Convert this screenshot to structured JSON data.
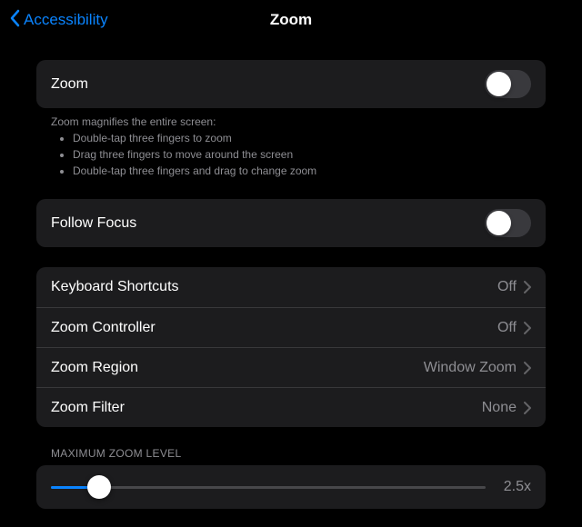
{
  "nav": {
    "back_label": "Accessibility",
    "title": "Zoom"
  },
  "zoom_toggle": {
    "label": "Zoom"
  },
  "zoom_help": {
    "intro": "Zoom magnifies the entire screen:",
    "tips": [
      "Double-tap three fingers to zoom",
      "Drag three fingers to move around the screen",
      "Double-tap three fingers and drag to change zoom"
    ]
  },
  "follow_focus": {
    "label": "Follow Focus"
  },
  "options": {
    "keyboard_shortcuts": {
      "label": "Keyboard Shortcuts",
      "value": "Off"
    },
    "zoom_controller": {
      "label": "Zoom Controller",
      "value": "Off"
    },
    "zoom_region": {
      "label": "Zoom Region",
      "value": "Window Zoom"
    },
    "zoom_filter": {
      "label": "Zoom Filter",
      "value": "None"
    }
  },
  "max_zoom": {
    "header": "Maximum Zoom Level",
    "value_text": "2.5x"
  }
}
